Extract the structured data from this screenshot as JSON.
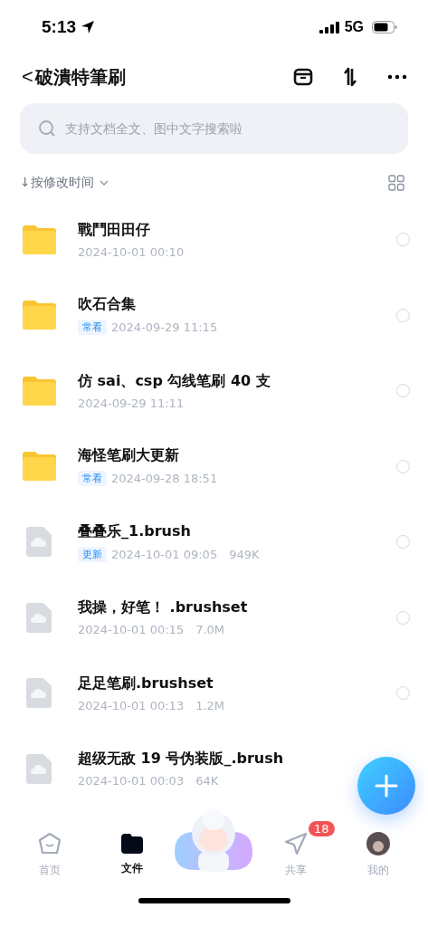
{
  "status_bar": {
    "time": "5:13",
    "network": "5G"
  },
  "nav": {
    "back": "<",
    "title": "破潰特筆刷"
  },
  "search": {
    "placeholder": "支持文档全文、图中文字搜索啦"
  },
  "sort": {
    "label": "↓按修改时间"
  },
  "files": [
    {
      "kind": "folder",
      "name": "戰鬥田田仔",
      "date": "2024-10-01 00:10",
      "selected": false
    },
    {
      "kind": "folder",
      "name": "吹石合集",
      "tag": "常看",
      "date": "2024-09-29 11:15",
      "selected": false
    },
    {
      "kind": "folder",
      "name": "仿 sai、csp 勾线笔刷 40 支",
      "date": "2024-09-29 11:11",
      "selected": false
    },
    {
      "kind": "folder",
      "name": "海怪笔刷大更新",
      "tag": "常看",
      "date": "2024-09-28 18:51",
      "selected": false
    },
    {
      "kind": "file",
      "name": "叠叠乐_1.brush",
      "tag": "更新",
      "date": "2024-10-01 09:05",
      "size": "949K",
      "selected": false
    },
    {
      "kind": "file",
      "name": "我操，好笔！ .brushset",
      "date": "2024-10-01 00:15",
      "size": "7.0M",
      "selected": false
    },
    {
      "kind": "file",
      "name": "足足笔刷.brushset",
      "date": "2024-10-01 00:13",
      "size": "1.2M",
      "selected": false
    },
    {
      "kind": "file",
      "name": "超级无敌 19 号伪装版_.brush",
      "date": "2024-10-01 00:03",
      "size": "64K"
    }
  ],
  "tabs": [
    {
      "kind": "home",
      "label": "首页",
      "selected": false
    },
    {
      "kind": "files",
      "label": "文件",
      "selected": true
    },
    {
      "kind": "mascot",
      "selected": false
    },
    {
      "kind": "share",
      "label": "共享",
      "badge": "18",
      "selected": false
    },
    {
      "kind": "mine",
      "label": "我的",
      "selected": false
    }
  ]
}
